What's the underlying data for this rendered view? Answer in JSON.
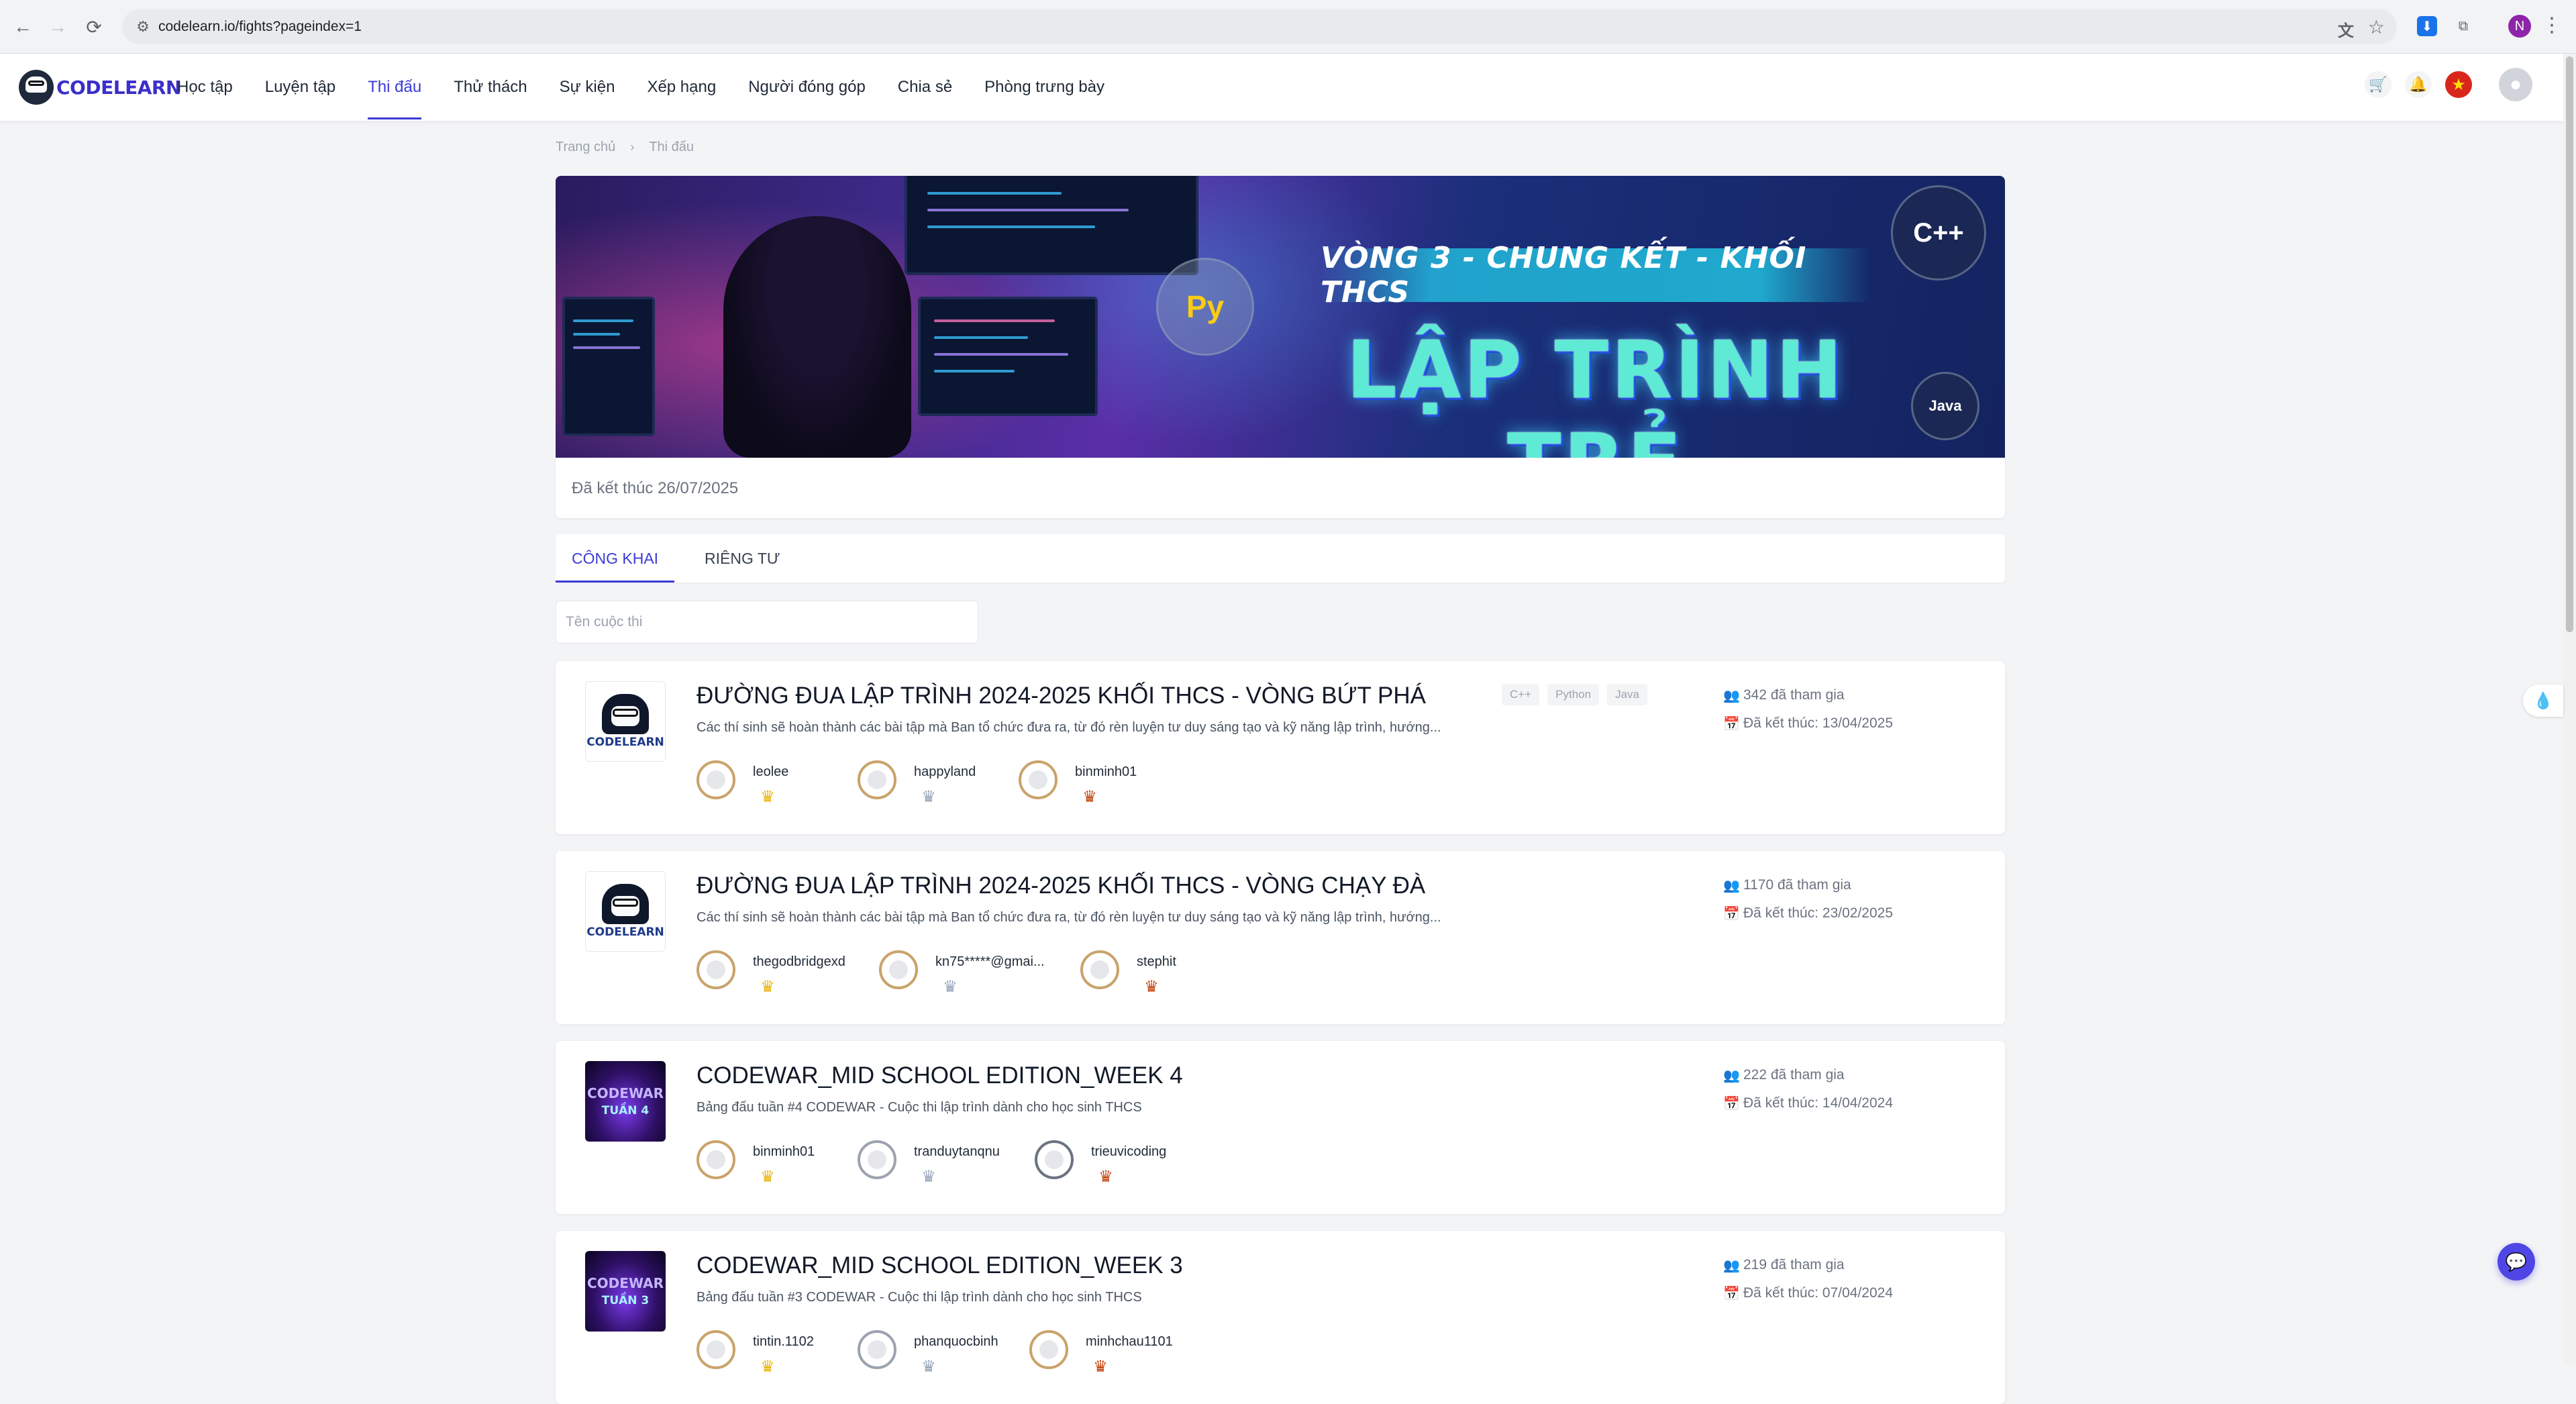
{
  "browser": {
    "url": "codelearn.io/fights?pageindex=1",
    "profile_initial": "N",
    "back_icon": "←",
    "forward_icon": "→",
    "reload_icon": "⟳",
    "star_icon": "☆",
    "menu_icon": "⋮"
  },
  "header": {
    "logo_text": "CODELEARN",
    "nav": [
      "Học tập",
      "Luyện tập",
      "Thi đấu",
      "Thử thách",
      "Sự kiện",
      "Xếp hạng",
      "Người đóng góp",
      "Chia sẻ",
      "Phòng trưng bày"
    ],
    "active_nav": "Thi đấu",
    "accent_color": "#3b3bd6"
  },
  "breadcrumb": {
    "home": "Trang chủ",
    "current": "Thi đấu"
  },
  "banner": {
    "ribbon_text": "VÒNG 3 - CHUNG KẾT - KHỐI THCS",
    "main_title": "LẬP TRÌNH TRẺ",
    "badges": {
      "cpp": "C++",
      "java": "Java"
    },
    "status": "Đã kết thúc 26/07/2025"
  },
  "tabs": {
    "public": "CÔNG KHAI",
    "private": "RIÊNG TƯ"
  },
  "search": {
    "placeholder": "Tên cuộc thi",
    "value": ""
  },
  "contests": [
    {
      "title": "ĐƯỜNG ĐUA LẬP TRÌNH 2024-2025 KHỐI THCS - VÒNG BỨT PHÁ",
      "description": "Các thí sinh sẽ hoàn thành các bài tập mà Ban tổ chức đưa ra, từ đó rèn luyện tư duy sáng tạo và kỹ năng lập trình, hướng...",
      "tags": [
        "C++",
        "Python",
        "Java"
      ],
      "participants": "342 đã tham gia",
      "ended": "Đã kết thúc: 13/04/2025",
      "winners": [
        "leolee",
        "happyland",
        "binminh01"
      ]
    },
    {
      "title": "ĐƯỜNG ĐUA LẬP TRÌNH 2024-2025 KHỐI THCS - VÒNG CHẠY ĐÀ",
      "description": "Các thí sinh sẽ hoàn thành các bài tập mà Ban tổ chức đưa ra, từ đó rèn luyện tư duy sáng tạo và kỹ năng lập trình, hướng...",
      "tags": [],
      "participants": "1170 đã tham gia",
      "ended": "Đã kết thúc: 23/02/2025",
      "winners": [
        "thegodbridgexd",
        "kn75*****@gmai...",
        "stephit"
      ]
    },
    {
      "title": "CODEWAR_MID SCHOOL EDITION_WEEK 4",
      "description": "Bảng đấu tuần #4 CODEWAR - Cuộc thi lập trình dành cho học sinh THCS",
      "tags": [],
      "participants": "222 đã tham gia",
      "ended": "Đã kết thúc: 14/04/2024",
      "winners": [
        "binminh01",
        "tranduytanqnu",
        "trieuvicoding"
      ]
    },
    {
      "title": "CODEWAR_MID SCHOOL EDITION_WEEK 3",
      "description": "Bảng đấu tuần #3 CODEWAR - Cuộc thi lập trình dành cho học sinh THCS",
      "tags": [],
      "participants": "219 đã tham gia",
      "ended": "Đã kết thúc: 07/04/2024",
      "winners": [
        "tintin.1102",
        "phanquocbinh",
        "minhchau1101"
      ]
    }
  ],
  "thumbs": {
    "codelearn_text": "CODELEARN",
    "codewar_text": "CODEWAR",
    "week4_text": "TUẦN 4",
    "week3_text": "TUẦN 3"
  }
}
